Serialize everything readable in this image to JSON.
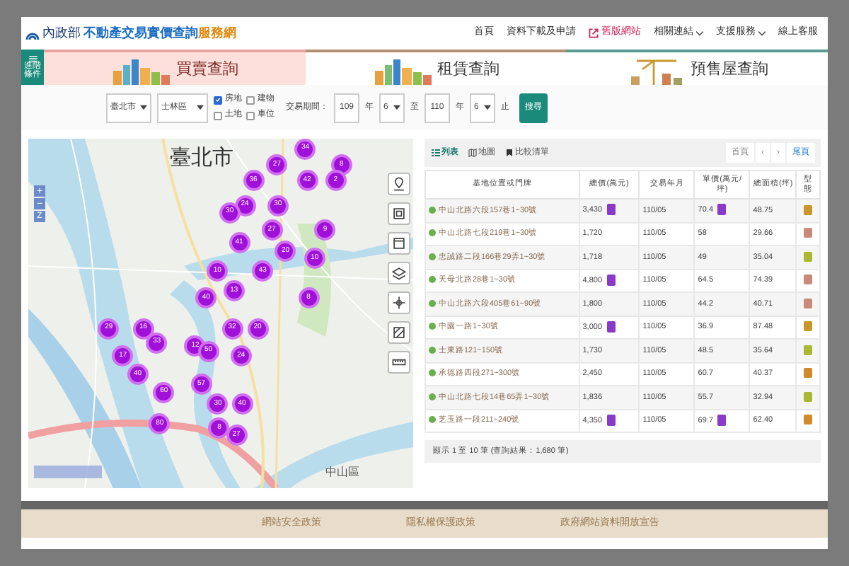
{
  "header": {
    "logo_prefix": "內政部",
    "logo_title": "不動產交易實價查詢",
    "logo_suffix": "服務網",
    "nav": [
      {
        "label": "首頁",
        "kind": "plain"
      },
      {
        "label": "資料下載及申請",
        "kind": "plain"
      },
      {
        "label": "舊版網站",
        "kind": "external"
      },
      {
        "label": "相關連結",
        "kind": "dropdown"
      },
      {
        "label": "支援服務",
        "kind": "dropdown"
      },
      {
        "label": "線上客服",
        "kind": "plain"
      }
    ]
  },
  "side_tab": "進階條件",
  "tabs": [
    {
      "label": "買賣查詢",
      "selected": true
    },
    {
      "label": "租賃查詢",
      "selected": false
    },
    {
      "label": "預售屋查詢",
      "selected": false
    }
  ],
  "filters": {
    "city": "臺北市",
    "district": "士林區",
    "types": [
      {
        "label": "房地",
        "checked": true
      },
      {
        "label": "建物",
        "checked": false
      },
      {
        "label": "土地",
        "checked": false
      },
      {
        "label": "車位",
        "checked": false
      }
    ],
    "period_label": "交易期間：",
    "from_year": "109",
    "year_unit_1": "年",
    "from_month": "6",
    "to_label": "至",
    "to_year": "110",
    "year_unit_2": "年",
    "to_month": "6",
    "end_label": "止",
    "search_button": "搜尋"
  },
  "map": {
    "city_label": "臺北市",
    "district_label": "中山區",
    "zoom_in": "+",
    "zoom_out": "−",
    "reset": "Z",
    "clusters": [
      "34",
      "27",
      "8",
      "36",
      "42",
      "2",
      "30",
      "24",
      "30",
      "27",
      "9",
      "41",
      "20",
      "10",
      "10",
      "43",
      "13",
      "40",
      "8",
      "29",
      "16",
      "33",
      "12",
      "50",
      "32",
      "20",
      "24",
      "17",
      "40",
      "57",
      "60",
      "30",
      "40",
      "80",
      "8",
      "27"
    ]
  },
  "results": {
    "views": [
      {
        "label": "列表",
        "selected": true
      },
      {
        "label": "地圖",
        "selected": false
      },
      {
        "label": "比較清單",
        "selected": false
      }
    ],
    "pager": [
      "首頁",
      "‹",
      "›",
      "尾頁"
    ],
    "columns": [
      "基地位置或門牌",
      "總價(萬元)",
      "交易年月",
      "單價(萬元/坪)",
      "總面積(坪)",
      "型態"
    ],
    "rows": [
      {
        "address": "中山北路六段157巷1~30號",
        "price": "3,430",
        "price_note": true,
        "date": "110/05",
        "unit": "70.4",
        "unit_note": true,
        "area": "48.75",
        "color": "#c8962a"
      },
      {
        "address": "中山北路七段219巷1~30號",
        "price": "1,720",
        "price_note": false,
        "date": "110/05",
        "unit": "58",
        "unit_note": false,
        "area": "29.66",
        "color": "#c98a7a"
      },
      {
        "address": "忠誠路二段166巷29弄1~30號",
        "price": "1,718",
        "price_note": false,
        "date": "110/05",
        "unit": "49",
        "unit_note": false,
        "area": "35.04",
        "color": "#a8b830"
      },
      {
        "address": "天母北路28巷1~30號",
        "price": "4,800",
        "price_note": true,
        "date": "110/05",
        "unit": "64.5",
        "unit_note": false,
        "area": "74.39",
        "color": "#c98a7a"
      },
      {
        "address": "中山北路六段405巷61~90號",
        "price": "1,800",
        "price_note": false,
        "date": "110/05",
        "unit": "44.2",
        "unit_note": false,
        "area": "40.71",
        "color": "#c98a7a"
      },
      {
        "address": "中園一路1~30號",
        "price": "3,000",
        "price_note": true,
        "date": "110/05",
        "unit": "36.9",
        "unit_note": false,
        "area": "87.48",
        "color": "#c8962a"
      },
      {
        "address": "士東路121~150號",
        "price": "1,730",
        "price_note": false,
        "date": "110/05",
        "unit": "48.5",
        "unit_note": false,
        "area": "35.64",
        "color": "#a8b830"
      },
      {
        "address": "承德路四段271~300號",
        "price": "2,450",
        "price_note": false,
        "date": "110/05",
        "unit": "60.7",
        "unit_note": false,
        "area": "40.37",
        "color": "#d08a2a"
      },
      {
        "address": "中山北路七段14巷65弄1~30號",
        "price": "1,836",
        "price_note": false,
        "date": "110/05",
        "unit": "55.7",
        "unit_note": false,
        "area": "32.94",
        "color": "#a8b830"
      },
      {
        "address": "芝玉路一段211~240號",
        "price": "4,350",
        "price_note": true,
        "date": "110/05",
        "unit": "69.7",
        "unit_note": true,
        "area": "62.40",
        "color": "#d08a2a"
      }
    ],
    "summary": "顯示 1 至 10 筆 (查詢結果：1,680 筆)"
  },
  "footer": [
    "網站安全政策",
    "隱私權保護政策",
    "政府網站資料開放宣告"
  ]
}
